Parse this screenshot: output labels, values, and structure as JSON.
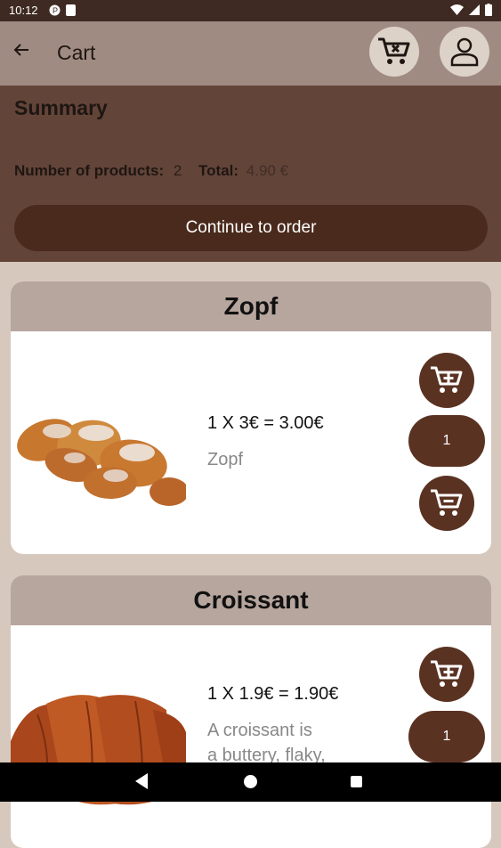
{
  "status": {
    "time": "10:12"
  },
  "app_bar": {
    "title": "Cart",
    "back_icon": "arrow-left-icon"
  },
  "summary": {
    "title": "Summary",
    "count_label": "Number of products:",
    "count_value": "2",
    "total_label": "Total:",
    "total_value": "4.90 €",
    "order_button": "Continue to order"
  },
  "products": [
    {
      "name": "Zopf",
      "price_line": "1 X 3€ = 3.00€",
      "desc1": "Zopf",
      "desc2": "",
      "quantity": "1"
    },
    {
      "name": "Croissant",
      "price_line": "1 X 1.9€ = 1.90€",
      "desc1": "A croissant is",
      "desc2": "a buttery, flaky,",
      "quantity": "1"
    }
  ],
  "colors": {
    "accent": "#5a3222",
    "header": "#a08b82",
    "summary_bg": "#634439"
  }
}
